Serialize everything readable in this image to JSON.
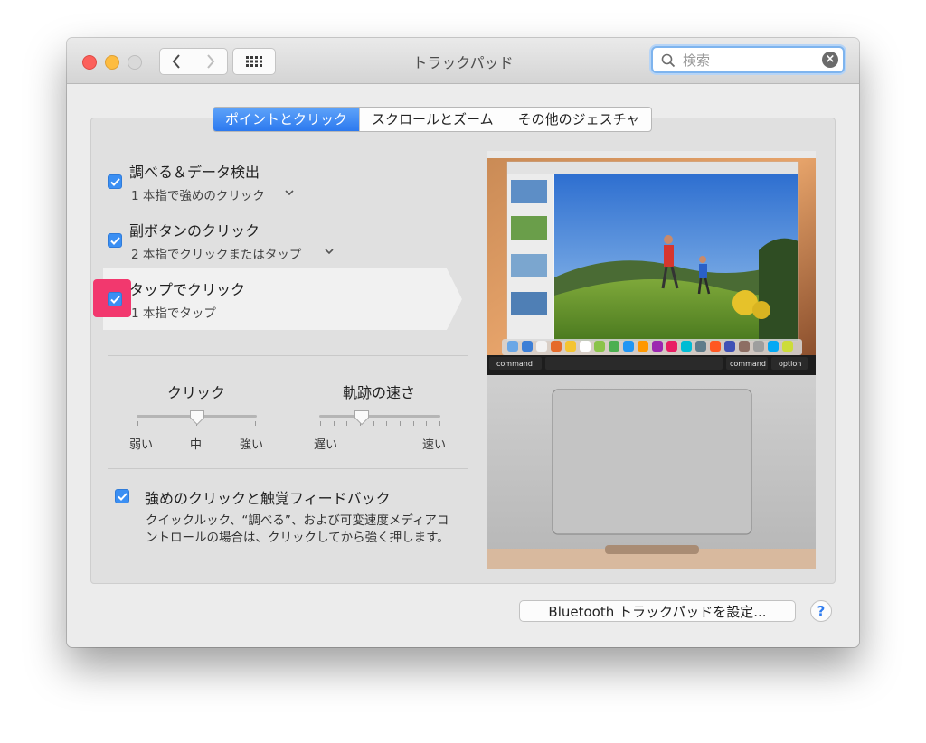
{
  "window": {
    "title": "トラックパッド"
  },
  "search": {
    "placeholder": "検索"
  },
  "tabs": [
    {
      "label": "ポイントとクリック",
      "active": true
    },
    {
      "label": "スクロールとズーム",
      "active": false
    },
    {
      "label": "その他のジェスチャ",
      "active": false
    }
  ],
  "options": [
    {
      "title": "調べる＆データ検出",
      "subtitle": "1 本指で強めのクリック",
      "checked": true
    },
    {
      "title": "副ボタンのクリック",
      "subtitle": "2 本指でクリックまたはタップ",
      "checked": true
    },
    {
      "title": "タップでクリック",
      "subtitle": "1 本指でタップ",
      "checked": true
    }
  ],
  "click_slider": {
    "label": "クリック",
    "min_label": "弱い",
    "mid_label": "中",
    "max_label": "強い",
    "value_fraction": 0.5
  },
  "speed_slider": {
    "label": "軌跡の速さ",
    "min_label": "遅い",
    "max_label": "速い",
    "value_fraction": 0.35
  },
  "force_click": {
    "title": "強めのクリックと触覚フィードバック",
    "description": "クイックルック、“調べる”、および可変速度メディアコントロールの場合は、クリックしてから強く押します。",
    "checked": true
  },
  "preview": {
    "keys": [
      "command",
      "command",
      "option"
    ]
  },
  "footer": {
    "bluetooth_button": "Bluetooth トラックパッドを設定...",
    "help": "?"
  },
  "colors": {
    "accent": "#3b8ff3",
    "highlight_box": "#f2386e"
  }
}
